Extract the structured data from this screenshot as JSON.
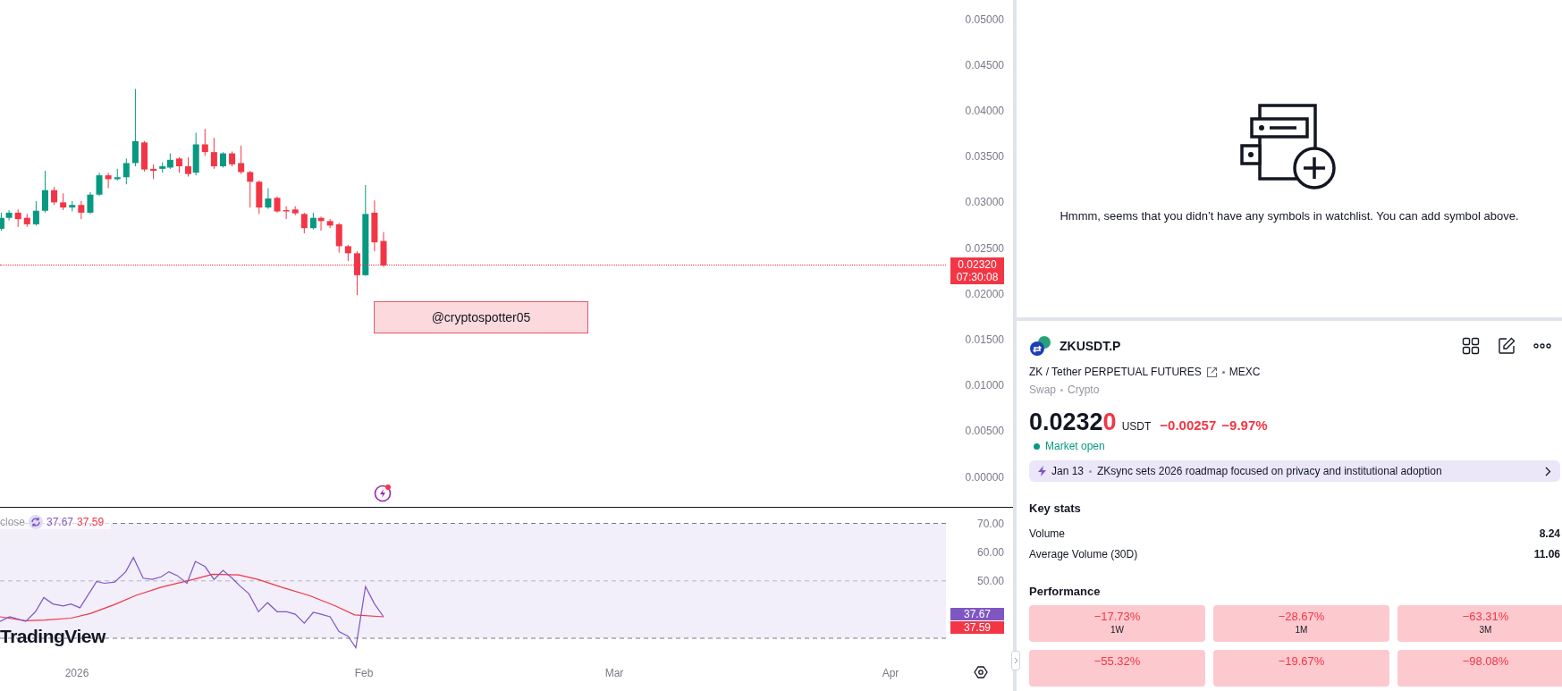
{
  "chart": {
    "price_scale": [
      "0.05000",
      "0.04500",
      "0.04000",
      "0.03500",
      "0.03000",
      "0.02500",
      "0.02000",
      "0.01500",
      "0.01000",
      "0.00500",
      "0.00000"
    ],
    "last_price": {
      "price": "0.02320",
      "countdown": "07:30:08"
    },
    "note": "@cryptospotter05",
    "logo": "TradingView",
    "time_scale": [
      "2026",
      "Feb",
      "Mar",
      "Apr"
    ]
  },
  "rsi": {
    "legend_label": "close",
    "legend_values": [
      {
        "text": "37.67",
        "color": "#7e57c2"
      },
      {
        "text": "37.59",
        "color": "#f23645"
      }
    ],
    "scale": [
      "70.00",
      "60.00",
      "50.00"
    ],
    "badges": [
      {
        "text": "37.67",
        "color": "#7e57c2"
      },
      {
        "text": "37.59",
        "color": "#f23645"
      }
    ]
  },
  "watchlist": {
    "empty_message": "Hmmm, seems that you didn’t have any symbols in watchlist. You can add symbol above."
  },
  "symbol": {
    "ticker": "ZKUSDT.P",
    "description": "ZK / Tether PERPETUAL FUTURES",
    "exchange": "MEXC",
    "tags": [
      "Swap",
      "Crypto"
    ],
    "price_main": "0.0232",
    "price_tail": "0",
    "currency": "USDT",
    "change": "−0.00257",
    "change_percent": "−9.97%",
    "status": "Market open",
    "news": {
      "date": "Jan 13",
      "headline": "ZKsync sets 2026 roadmap focused on privacy and institutional adoption"
    },
    "key_stats": {
      "title": "Key stats",
      "rows": [
        {
          "label": "Volume",
          "value": "8.24"
        },
        {
          "label": "Average Volume (30D)",
          "value": "11.06"
        }
      ]
    },
    "performance": {
      "title": "Performance",
      "cells": [
        {
          "value": "−17.73%",
          "period": "1W"
        },
        {
          "value": "−28.67%",
          "period": "1M"
        },
        {
          "value": "−63.31%",
          "period": "3M"
        },
        {
          "value": "−55.32%"
        },
        {
          "value": "−19.67%"
        },
        {
          "value": "−98.08%"
        }
      ]
    }
  }
}
